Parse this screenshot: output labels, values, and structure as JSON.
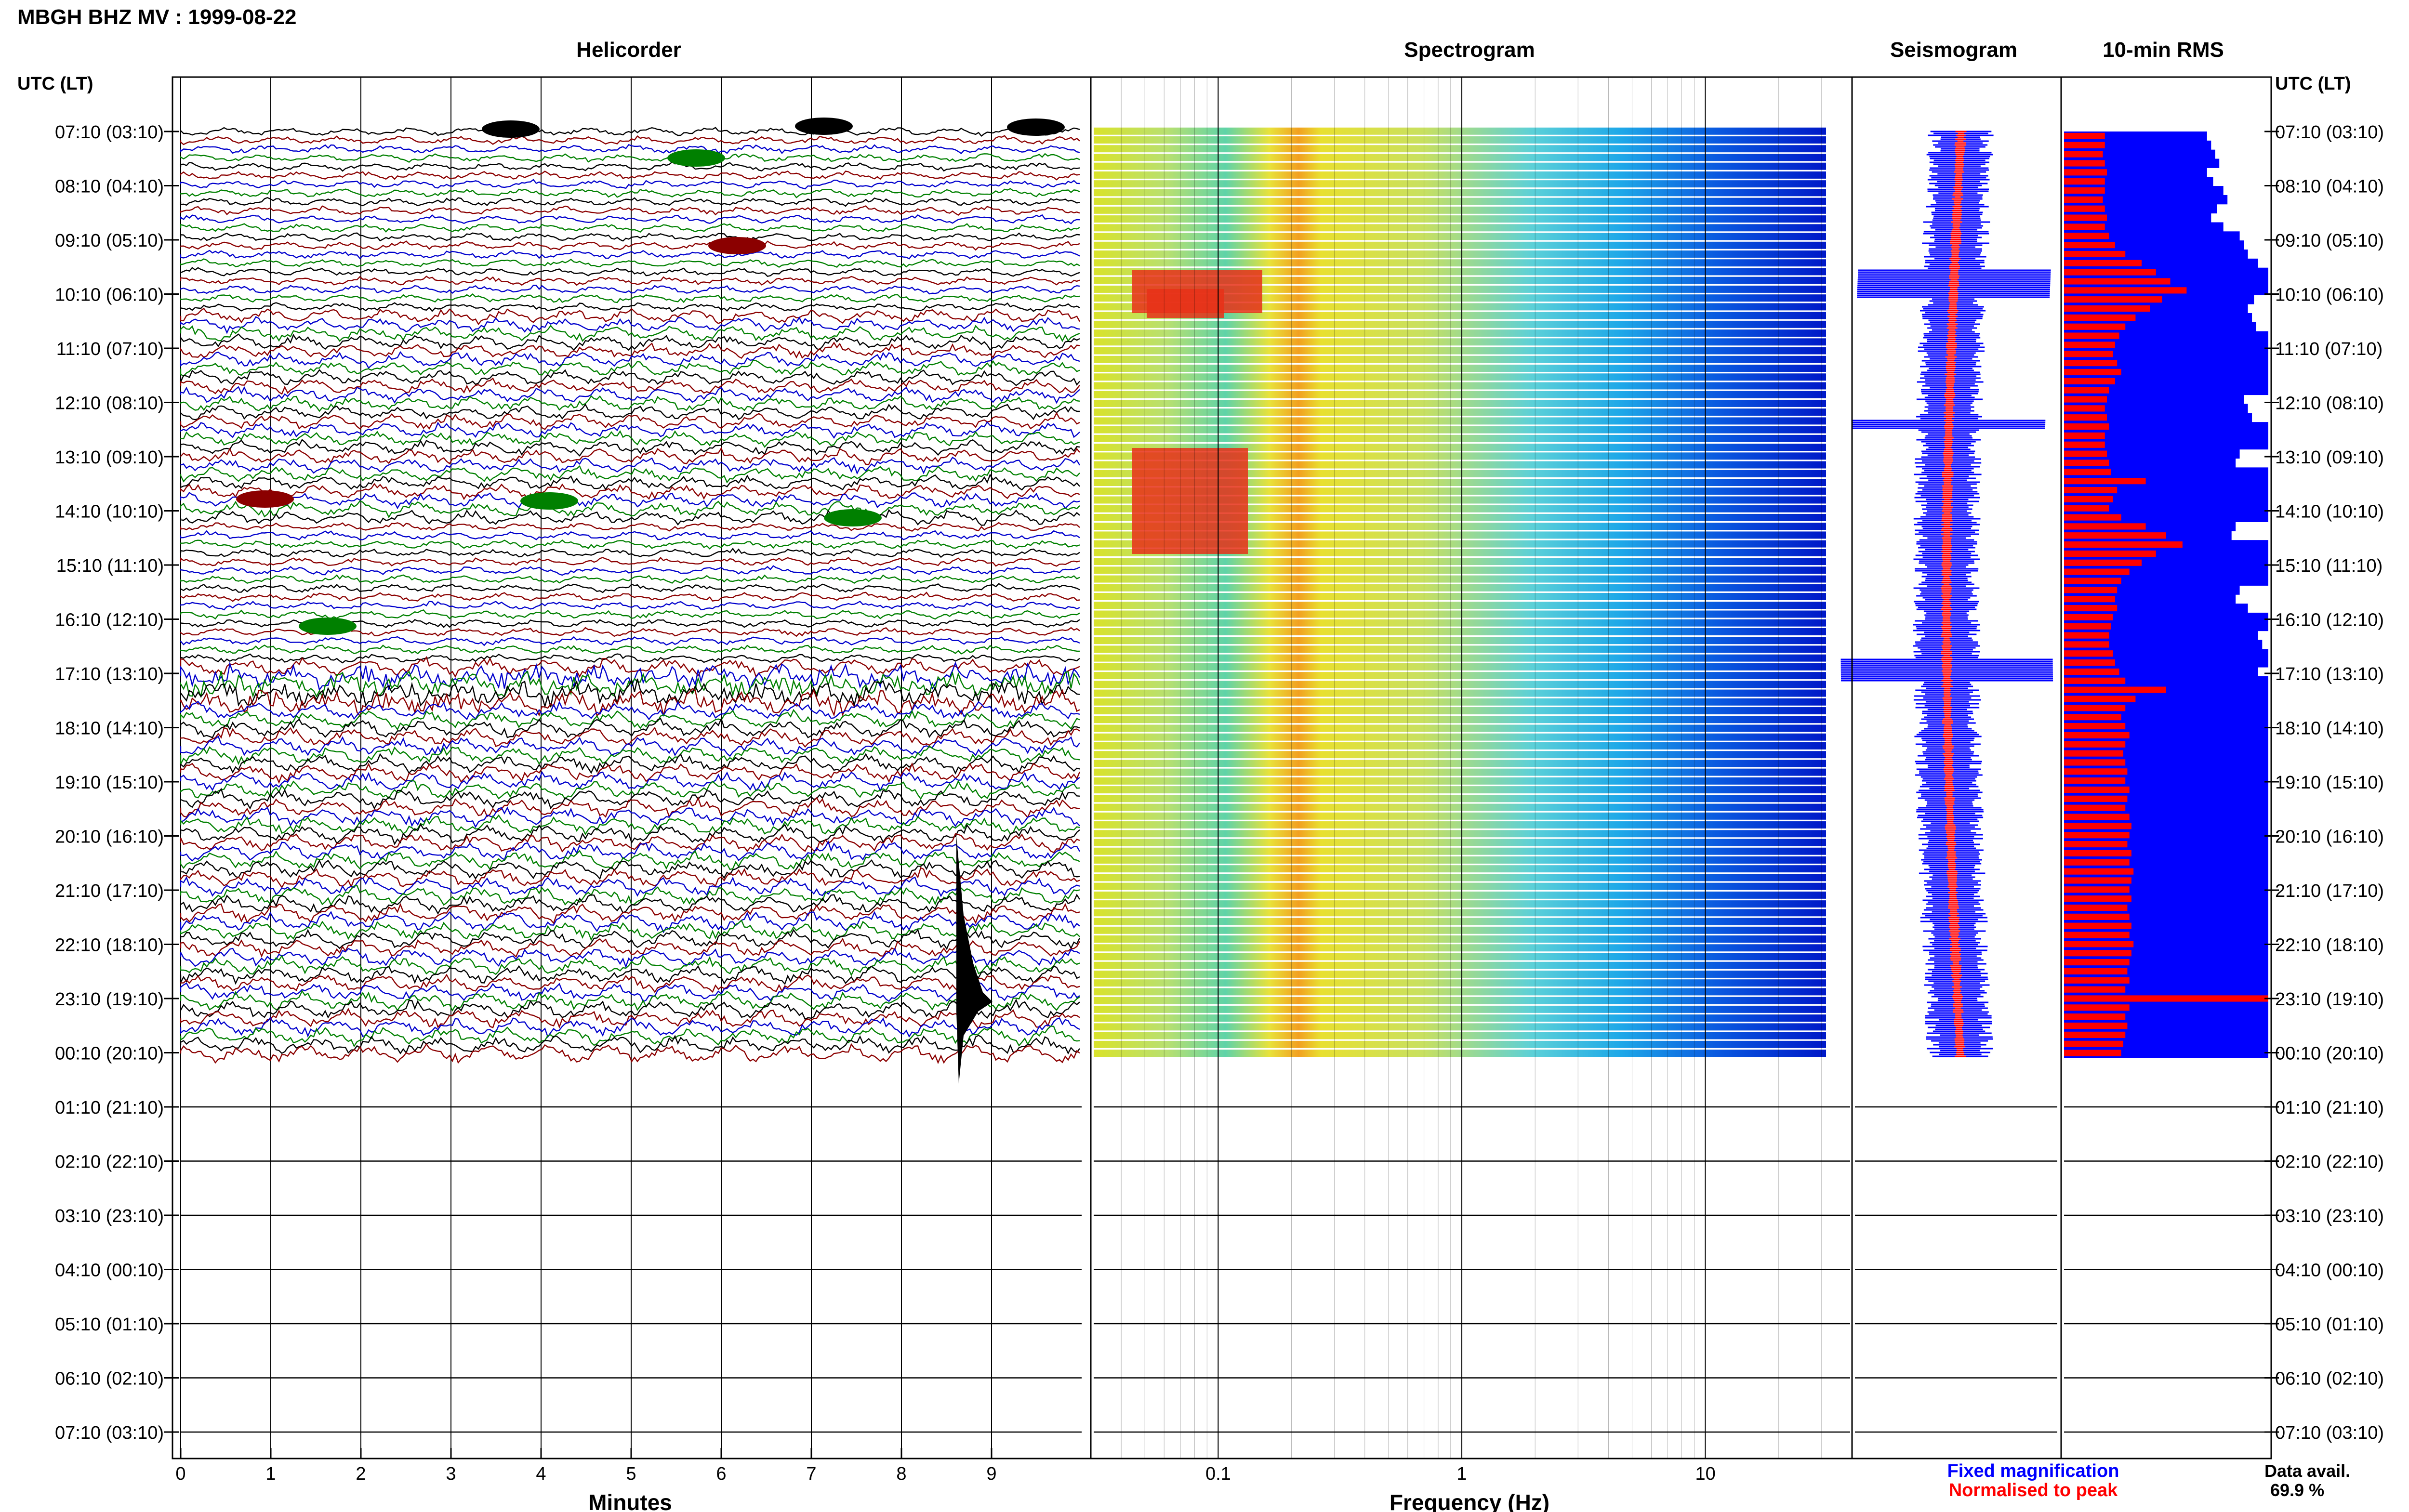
{
  "header": {
    "station_title": "MBGH BHZ MV : 1999-08-22"
  },
  "panels": {
    "helicorder_title": "Helicorder",
    "spectrogram_title": "Spectrogram",
    "seismogram_title": "Seismogram",
    "rms_title": "10-min RMS"
  },
  "axes": {
    "time_axis_label_left": "UTC (LT)",
    "time_axis_label_right": "UTC (LT)",
    "row_labels": [
      "07:10 (03:10)",
      "08:10 (04:10)",
      "09:10 (05:10)",
      "10:10 (06:10)",
      "11:10 (07:10)",
      "12:10 (08:10)",
      "13:10 (09:10)",
      "14:10 (10:10)",
      "15:10 (11:10)",
      "16:10 (12:10)",
      "17:10 (13:10)",
      "18:10 (14:10)",
      "19:10 (15:10)",
      "20:10 (16:10)",
      "21:10 (17:10)",
      "22:10 (18:10)",
      "23:10 (19:10)",
      "00:10 (20:10)",
      "01:10 (21:10)",
      "02:10 (22:10)",
      "03:10 (23:10)",
      "04:10 (00:10)",
      "05:10 (01:10)",
      "06:10 (02:10)",
      "07:10 (03:10)"
    ],
    "minutes_ticks": [
      "0",
      "1",
      "2",
      "3",
      "4",
      "5",
      "6",
      "7",
      "8",
      "9"
    ],
    "minutes_label": "Minutes",
    "frequency_ticks": [
      "0.1",
      "1",
      "10"
    ],
    "frequency_label": "Frequency (Hz)"
  },
  "legend": {
    "fixed_label": "Fixed magnification",
    "normalised_label": "Normalised to peak",
    "fixed_color": "#0000ff",
    "normalised_color": "#ff0000"
  },
  "availability": {
    "label": "Data avail.",
    "value": "69.9 %"
  },
  "chart_data": {
    "type": "heatmap",
    "title": "MBGH BHZ MV : 1999-08-22",
    "data_hours": 17,
    "total_hours": 24,
    "helicorder_colors": [
      "#000000",
      "#8b0000",
      "#0000cd",
      "#008000"
    ],
    "frequency_range_hz": [
      0.03,
      40
    ],
    "minutes_range": [
      0,
      10
    ],
    "rms_fixed": [
      0.7,
      0.72,
      0.74,
      0.76,
      0.7,
      0.73,
      0.78,
      0.8,
      0.75,
      0.72,
      0.78,
      0.86,
      0.88,
      0.9,
      0.95,
      1.0,
      1.0,
      1.0,
      0.93,
      0.9,
      0.92,
      0.94,
      1.0,
      1.0,
      1.0,
      1.0,
      1.0,
      1.0,
      1.0,
      0.88,
      0.9,
      0.92,
      1.0,
      1.0,
      1.0,
      0.86,
      0.84,
      1.0,
      1.0,
      1.0,
      1.0,
      1.0,
      1.0,
      0.84,
      0.82,
      1.0,
      1.0,
      1.0,
      1.0,
      1.0,
      0.86,
      0.84,
      0.9,
      1.0,
      1.0,
      0.95,
      0.97,
      1.0,
      1.0,
      0.95,
      1.0,
      1.0,
      1.0,
      1.0,
      1.0,
      1.0,
      1.0,
      1.0,
      1.0,
      1.0,
      1.0,
      1.0,
      1.0,
      1.0,
      1.0,
      1.0,
      1.0,
      1.0,
      1.0,
      1.0,
      1.0,
      1.0,
      1.0,
      1.0,
      1.0,
      1.0,
      1.0,
      1.0,
      1.0,
      1.0,
      1.0,
      1.0,
      1.0,
      1.0,
      1.0,
      1.0,
      1.0,
      1.0,
      1.0,
      1.0,
      1.0,
      1.0
    ],
    "rms_normalised": [
      0.2,
      0.2,
      0.19,
      0.2,
      0.21,
      0.2,
      0.2,
      0.19,
      0.2,
      0.21,
      0.2,
      0.22,
      0.25,
      0.3,
      0.38,
      0.45,
      0.52,
      0.6,
      0.48,
      0.42,
      0.35,
      0.3,
      0.27,
      0.25,
      0.24,
      0.26,
      0.28,
      0.25,
      0.22,
      0.21,
      0.2,
      0.21,
      0.22,
      0.2,
      0.2,
      0.21,
      0.22,
      0.23,
      0.4,
      0.26,
      0.24,
      0.22,
      0.28,
      0.4,
      0.5,
      0.58,
      0.45,
      0.38,
      0.32,
      0.28,
      0.26,
      0.25,
      0.26,
      0.24,
      0.23,
      0.22,
      0.22,
      0.24,
      0.25,
      0.27,
      0.3,
      0.5,
      0.35,
      0.3,
      0.28,
      0.3,
      0.32,
      0.3,
      0.29,
      0.3,
      0.31,
      0.3,
      0.32,
      0.31,
      0.3,
      0.32,
      0.33,
      0.32,
      0.31,
      0.33,
      0.32,
      0.34,
      0.33,
      0.32,
      0.33,
      0.31,
      0.32,
      0.33,
      0.32,
      0.34,
      0.33,
      0.32,
      0.31,
      0.32,
      0.3,
      1.0,
      0.32,
      0.3,
      0.31,
      0.3,
      0.29,
      0.28
    ]
  }
}
